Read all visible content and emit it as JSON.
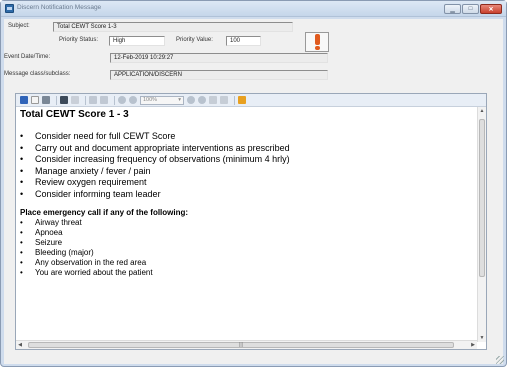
{
  "window": {
    "title": "Discern Notification Message",
    "buttons": {
      "minimize": "▁",
      "maximize": "□",
      "close": "✕"
    }
  },
  "form": {
    "subject_label": "Subject:",
    "subject_value": "Total CEWT Score 1-3",
    "priority_status_label": "Priority Status:",
    "priority_status_value": "High",
    "priority_value_label": "Priority Value:",
    "priority_value": "100",
    "event_datetime_label": "Event Date/Time:",
    "event_datetime_value": "12-Feb-2019 10:29:27",
    "message_class_label": "Message class/subclass:",
    "message_class_value": "APPLICATION/DISCERN",
    "alert_icon": "exclamation-icon"
  },
  "toolbar": {
    "icons": [
      "save-icon",
      "new-icon",
      "print-icon",
      "find-icon",
      "copy-icon",
      "paste-icon",
      "undo-icon",
      "redo-icon",
      "zoom-in-icon",
      "zoom-out-icon"
    ],
    "zoom": "100%"
  },
  "document": {
    "heading": "Total CEWT Score 1 - 3",
    "actions": [
      "Consider need for full CEWT Score",
      "Carry out and document appropriate interventions as prescribed",
      "Consider increasing frequency of observations (minimum 4 hrly)",
      "Manage anxiety / fever / pain",
      "Review oxygen requirement",
      "Consider informing team leader"
    ],
    "emergency_heading": "Place emergency call if any of the following:",
    "emergency_items": [
      "Airway threat",
      "Apnoea",
      "Seizure",
      "Bleeding (major)",
      "Any observation in the red area",
      "You are worried about the patient"
    ]
  },
  "colors": {
    "alert": "#e05a1e",
    "chrome": "#cfdced",
    "close_button": "#c9412e"
  }
}
